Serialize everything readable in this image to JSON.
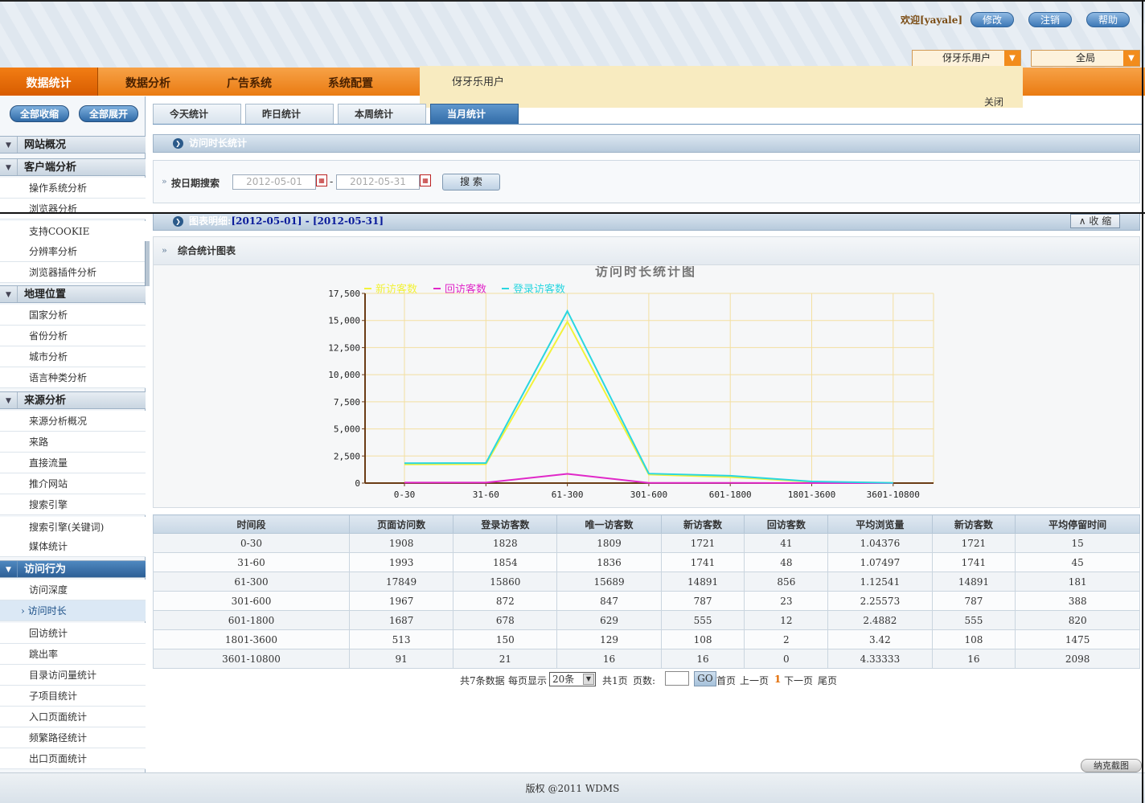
{
  "header": {
    "welcome": "欢迎[yayale]",
    "buttons": [
      "修改",
      "注销",
      "帮助"
    ],
    "select_user": "伢牙乐用户",
    "select_scope": "全局"
  },
  "nav": {
    "items": [
      "数据统计",
      "数据分析",
      "广告系统",
      "系统配置"
    ],
    "active": 0
  },
  "popup": {
    "text": "伢牙乐用户",
    "close": "关闭"
  },
  "sidebar": {
    "collapse_all": "全部收缩",
    "expand_all": "全部展开",
    "groups": {
      "site": "网站概况",
      "client": "客户端分析",
      "geo": "地理位置",
      "source": "来源分析",
      "behavior": "访问行为"
    },
    "client_items": [
      "操作系统分析",
      "浏览器分析",
      "支持COOKIE",
      "分辨率分析",
      "浏览器插件分析"
    ],
    "geo_items": [
      "国家分析",
      "省份分析",
      "城市分析",
      "语言种类分析"
    ],
    "source_items": [
      "来源分析概况",
      "来路",
      "直接流量",
      "推介网站",
      "搜索引擎",
      "搜索引擎(关键词)",
      "媒体统计"
    ],
    "behavior_items": [
      "访问深度",
      "访问时长",
      "回访统计",
      "跳出率",
      "目录访问量统计",
      "子项目统计",
      "入口页面统计",
      "频繁路径统计",
      "出口页面统计"
    ]
  },
  "tabs": [
    "今天统计",
    "昨日统计",
    "本周统计",
    "当月统计"
  ],
  "section_title": "访问时长统计",
  "search": {
    "label": "按日期搜索",
    "date_from": "2012-05-01",
    "date_to": "2012-05-31",
    "dash": "-",
    "button": "搜 索"
  },
  "detail": {
    "label": "图表明细:",
    "range": "[2012-05-01] - [2012-05-31]",
    "collapse": "收 缩"
  },
  "chart_panel_title": "综合统计图表",
  "chart_data": {
    "type": "line",
    "title": "访问时长统计图",
    "categories": [
      "0-30",
      "31-60",
      "61-300",
      "301-600",
      "601-1800",
      "1801-3600",
      "3601-10800"
    ],
    "ylim": [
      0,
      17500
    ],
    "yticks": [
      "0",
      "2,500",
      "5,000",
      "7,500",
      "10,000",
      "12,500",
      "15,000",
      "17,500"
    ],
    "yvalues": [
      0,
      2500,
      5000,
      7500,
      10000,
      12500,
      15000,
      17500
    ],
    "grid": true,
    "legend_position": "top",
    "series": [
      {
        "name": "新访客数",
        "color": "#f2f23a",
        "values": [
          1721,
          1741,
          14891,
          787,
          555,
          108,
          16
        ]
      },
      {
        "name": "回访客数",
        "color": "#e028c8",
        "values": [
          41,
          48,
          856,
          23,
          12,
          2,
          0
        ]
      },
      {
        "name": "登录访客数",
        "color": "#2ad6e0",
        "values": [
          1828,
          1854,
          15860,
          872,
          678,
          150,
          21
        ]
      }
    ]
  },
  "table": {
    "headers": [
      "时间段",
      "页面访问数",
      "登录访客数",
      "唯一访客数",
      "新访客数",
      "回访客数",
      "平均浏览量",
      "新访客数",
      "平均停留时间"
    ],
    "rows": [
      [
        "0-30",
        "1908",
        "1828",
        "1809",
        "1721",
        "41",
        "1.04376",
        "1721",
        "15"
      ],
      [
        "31-60",
        "1993",
        "1854",
        "1836",
        "1741",
        "48",
        "1.07497",
        "1741",
        "45"
      ],
      [
        "61-300",
        "17849",
        "15860",
        "15689",
        "14891",
        "856",
        "1.12541",
        "14891",
        "181"
      ],
      [
        "301-600",
        "1967",
        "872",
        "847",
        "787",
        "23",
        "2.25573",
        "787",
        "388"
      ],
      [
        "601-1800",
        "1687",
        "678",
        "629",
        "555",
        "12",
        "2.4882",
        "555",
        "820"
      ],
      [
        "1801-3600",
        "513",
        "150",
        "129",
        "108",
        "2",
        "3.42",
        "108",
        "1475"
      ],
      [
        "3601-10800",
        "91",
        "21",
        "16",
        "16",
        "0",
        "4.33333",
        "16",
        "2098"
      ]
    ]
  },
  "pager": {
    "total": "共7条数据",
    "per_page_label": "每页显示",
    "per_page": "20条",
    "pages": "共1页",
    "page_label": "页数:",
    "go": "GO",
    "first": "首页",
    "prev": "上一页",
    "current": "1",
    "next": "下一页",
    "last": "尾页"
  },
  "footer": "版权 @2011 WDMS",
  "snip_button": "纳克截图"
}
